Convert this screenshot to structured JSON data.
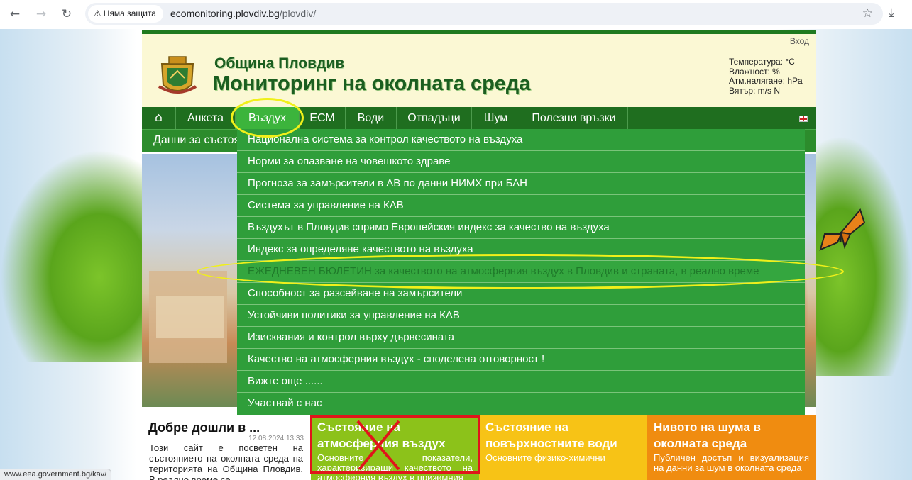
{
  "browser": {
    "security_label": "Няма защита",
    "url_host": "ecomonitoring.plovdiv.bg",
    "url_path": "/plovdiv/",
    "status_url": "www.eea.government.bg/kav/"
  },
  "header": {
    "login": "Вход",
    "subtitle": "Община Пловдив",
    "title": "Мониторинг на околната среда",
    "weather": {
      "temperature": "Температура: °C",
      "humidity": "Влажност: %",
      "pressure": "Атм.налягане: hPa",
      "wind": "Вятър: m/s N"
    }
  },
  "nav": {
    "home_icon": "home-icon",
    "items": [
      "Анкета",
      "Въздух",
      "ЕСМ",
      "Води",
      "Отпадъци",
      "Шум",
      "Полезни връзки"
    ],
    "active": "Въздух",
    "subbar": "Данни за състоя"
  },
  "dropdown": {
    "items": [
      "Национална система за контрол качеството на въздуха",
      "Норми за опазване на човешкото здраве",
      "Прогноза за замърсители в АВ по данни НИМХ при БАН",
      "Система за управление на КАВ",
      "Въздухът в Пловдив спрямо Европейския индекс за качество на въздуха",
      "Индекс за определяне качеството на въздуха",
      "ЕЖЕДНЕВЕН БЮЛЕТИН за качеството на атмосферния въздух в Пловдив и страната, в реално време",
      "Способност за разсейване на замърсители",
      "Устойчиви политики за управление на КАВ",
      "Изисквания и контрол върху дървесината",
      "Качество на атмосферния въздух - споделена отговорност !",
      "Вижте още ......",
      "Участвай с нас"
    ],
    "highlighted_index": 6
  },
  "welcome": {
    "title": "Добре дошли в ...",
    "date": "12.08.2024 13:33",
    "text": "Този сайт е посветен на състоянието на околната среда на територията на Община Пловдив. В реално време се"
  },
  "tiles": {
    "air": {
      "title": "Състояние на атмосферния въздух",
      "text": "Основните показатели, характеризиращи качеството на атмосферния въздух в приземния"
    },
    "water": {
      "title": "Състояние на повърхностните води",
      "text": "Основните физико-химични"
    },
    "noise": {
      "title": "Нивото на шума в околната среда",
      "text": "Публичен достъп и визуализация на данни за шум в околната среда"
    }
  },
  "colors": {
    "nav_dark": "#1f6e1f",
    "nav_active": "#3cb43c",
    "dropdown": "#2f9e3a",
    "highlight_ring": "#f0f01a",
    "tile_air": "#8cc21a",
    "tile_water": "#f7c316",
    "tile_noise": "#f08c10",
    "red_mark": "#e0151b"
  }
}
